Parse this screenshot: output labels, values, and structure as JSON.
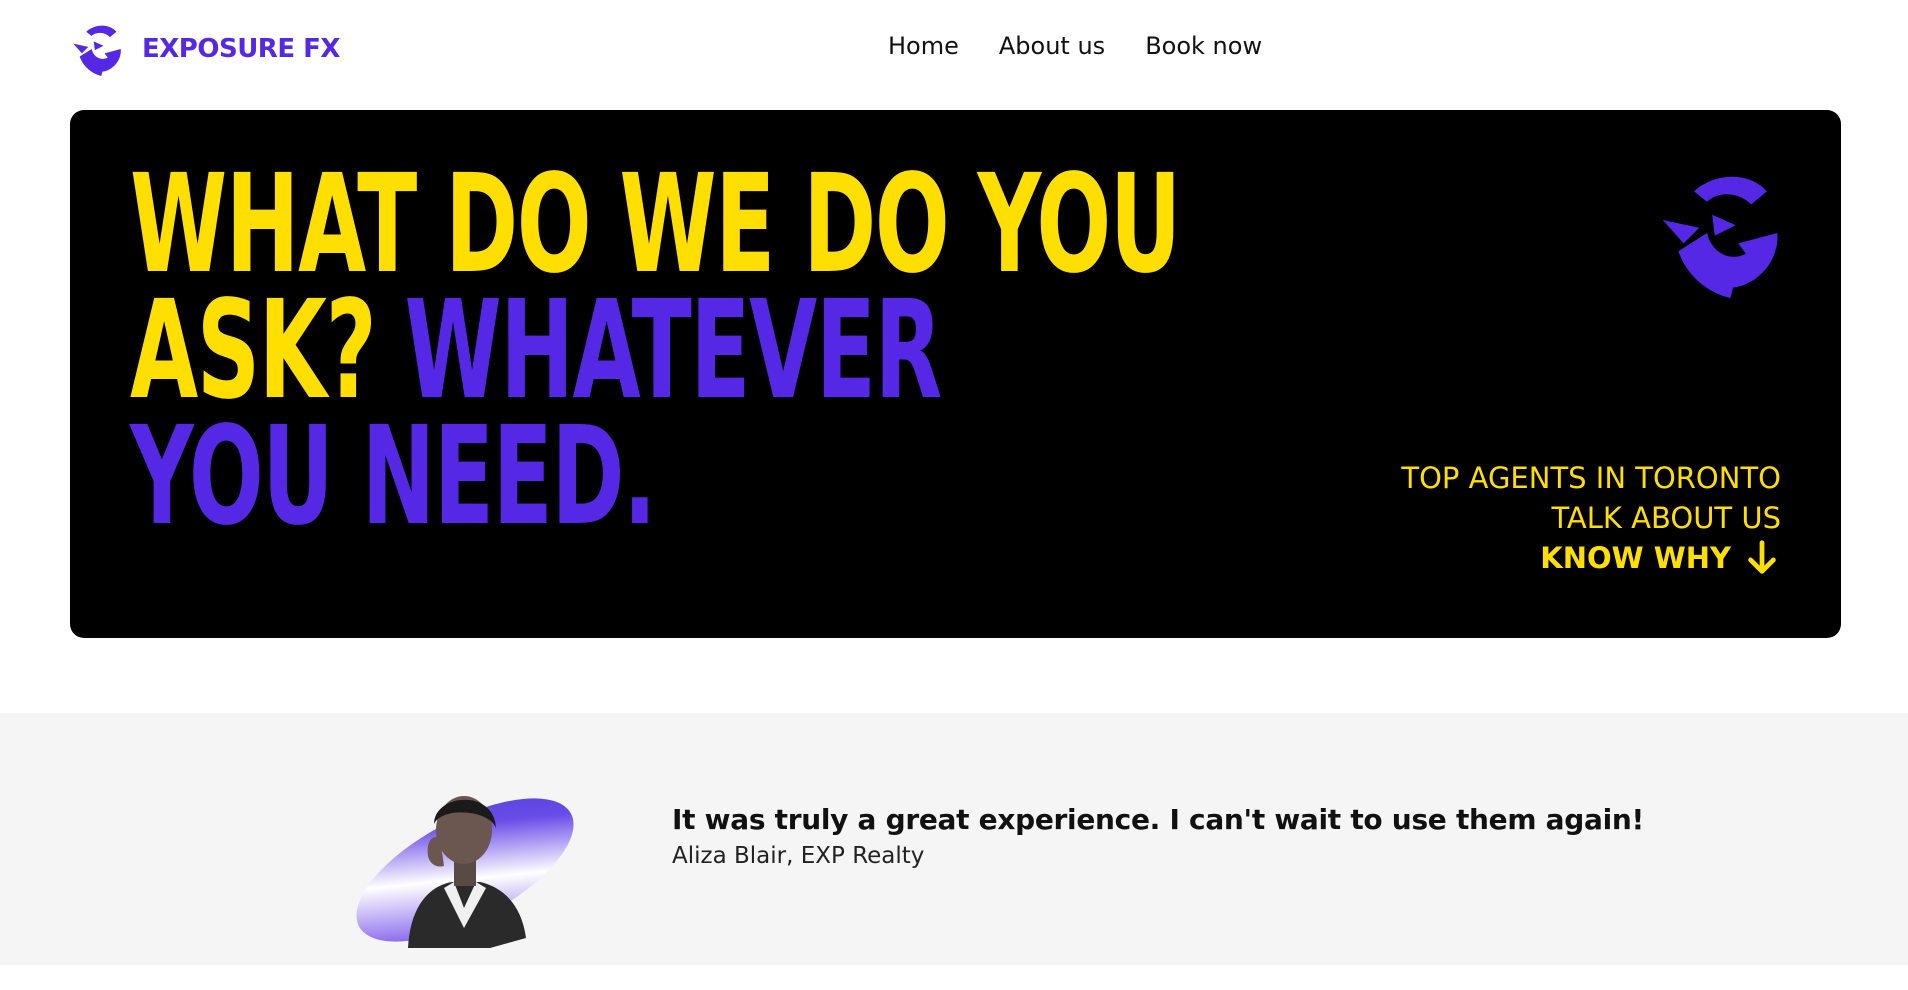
{
  "brand": {
    "name": "EXPOSURE FX",
    "logo_icon": "exposure-fx-logo-icon",
    "color": "#5528e6"
  },
  "nav": {
    "items": [
      {
        "label": "Home"
      },
      {
        "label": "About us"
      },
      {
        "label": "Book now"
      }
    ]
  },
  "hero": {
    "headline_line1": "WHAT DO WE DO YOU",
    "headline_line2_a": "ASK? ",
    "headline_line2_b": "WHATEVER",
    "headline_line3": "YOU NEED.",
    "tagline_line1": "TOP AGENTS IN TORONTO",
    "tagline_line2": "TALK ABOUT US",
    "cta_label": "KNOW WHY",
    "cta_icon": "arrow-down-icon",
    "accent_yellow": "#fedf00",
    "accent_purple": "#5528e6",
    "background": "#000000"
  },
  "testimonial": {
    "quote": "It was truly a great experience. I can't wait to use them again!",
    "author": "Aliza Blair, EXP Realty",
    "avatar_icon": "testimonial-avatar"
  }
}
